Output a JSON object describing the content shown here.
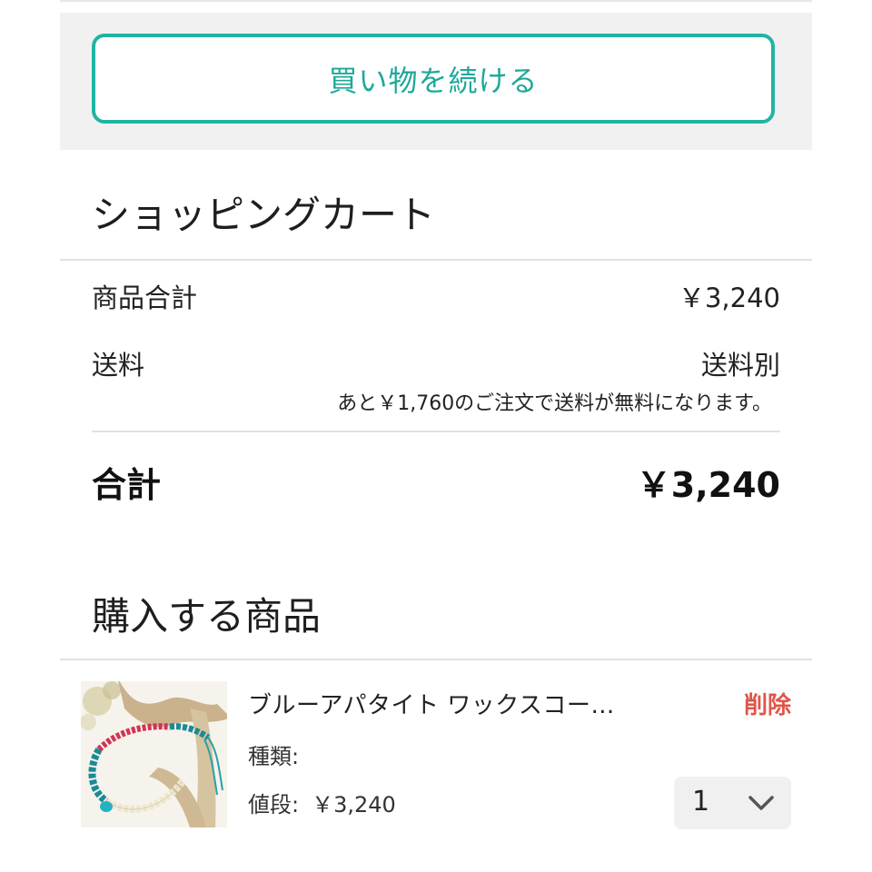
{
  "continue_button": {
    "label": "買い物を続ける"
  },
  "cart": {
    "title": "ショッピングカート",
    "subtotal_label": "商品合計",
    "subtotal_value": "￥3,240",
    "shipping_label": "送料",
    "shipping_value": "送料別",
    "free_shipping_note": "あと￥1,760のご注文で送料が無料になります。",
    "total_label": "合計",
    "total_value": "￥3,240"
  },
  "items_section": {
    "title": "購入する商品",
    "items": [
      {
        "name": "ブルーアパタイト ワックスコー…",
        "delete_label": "削除",
        "variant_label": "種類:",
        "variant_value": "",
        "price_label": "値段:",
        "price_value": "￥3,240",
        "quantity": "1",
        "thumbnail_icon": "bracelet-photo"
      }
    ]
  },
  "colors": {
    "accent": "#1fb5a3",
    "delete": "#e0554a",
    "band": "#f1f1f1"
  }
}
